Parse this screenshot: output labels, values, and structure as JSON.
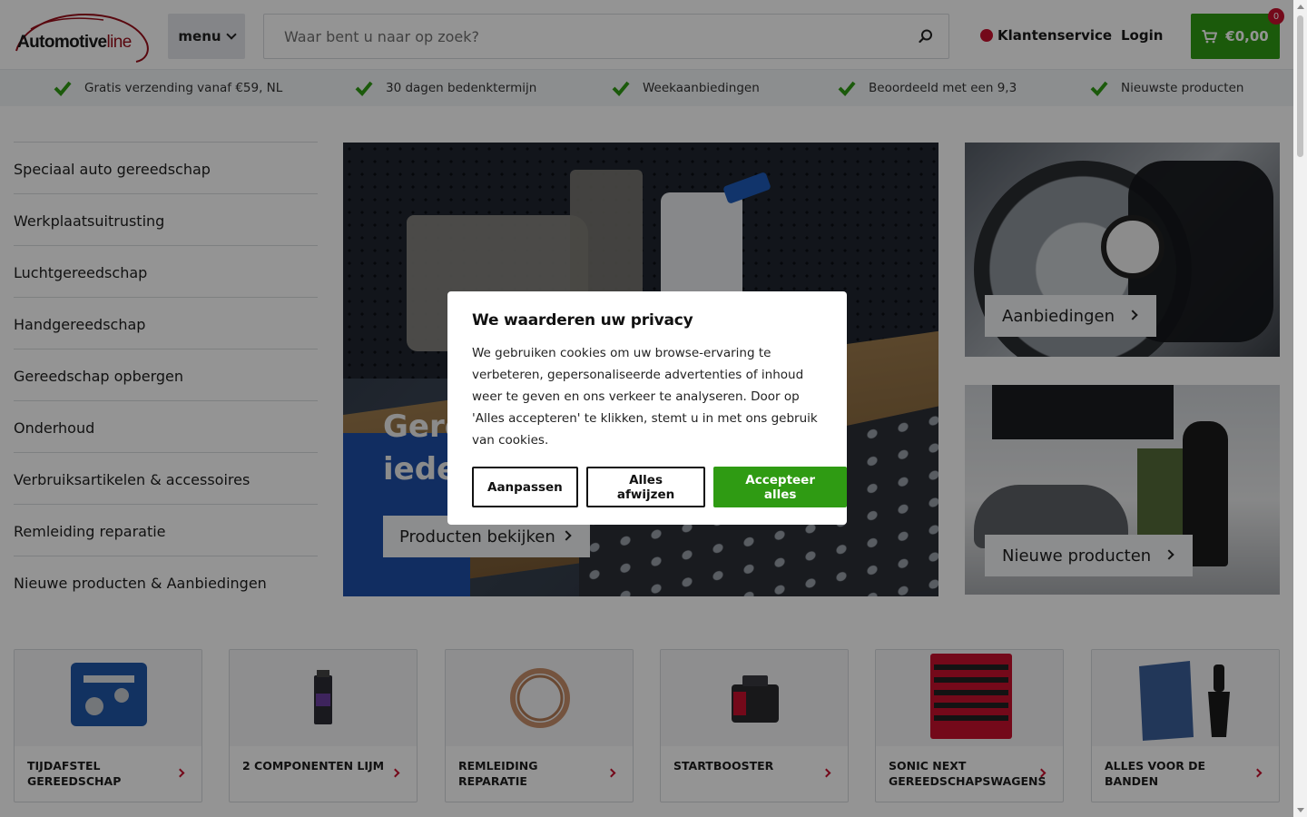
{
  "header": {
    "logo_main": "Automotive",
    "logo_accent": "line",
    "menu_label": "menu",
    "search_placeholder": "Waar bent u naar op zoek?",
    "service_label": "Klantenservice",
    "login_label": "Login",
    "cart_total": "€0,00",
    "cart_count": "0",
    "brand_color": "#2f9b13",
    "accent_color": "#c8102e"
  },
  "usp": [
    "Gratis verzending vanaf €59, NL",
    "30 dagen bedenktermijn",
    "Weekaanbiedingen",
    "Beoordeeld met een 9,3",
    "Nieuwste producten"
  ],
  "sidebar": {
    "items": [
      "Speciaal auto gereedschap",
      "Werkplaatsuitrusting",
      "Luchtgereedschap",
      "Handgereedschap",
      "Gereedschap opbergen",
      "Onderhoud",
      "Verbruiksartikelen & accessoires",
      "Remleiding reparatie",
      "Nieuwe producten & Aanbiedingen"
    ]
  },
  "hero": {
    "title_line1": "Gere",
    "title_line2": "iede",
    "button_label": "Producten bekijken"
  },
  "promos": {
    "offers_label": "Aanbiedingen",
    "new_label": "Nieuwe producten"
  },
  "categories": [
    {
      "label": "Tijdafstel gereedschap",
      "icon": "timing-tool-case"
    },
    {
      "label": "2 componenten lijm",
      "icon": "glue-tube"
    },
    {
      "label": "Remleiding reparatie",
      "icon": "copper-coil"
    },
    {
      "label": "Startbooster",
      "icon": "jump-starter"
    },
    {
      "label": "Sonic Next gereedschapswagens",
      "icon": "tool-trolley"
    },
    {
      "label": "Alles voor de banden",
      "icon": "tyre-valves"
    }
  ],
  "cookie_modal": {
    "title": "We waarderen uw privacy",
    "body": "We gebruiken cookies om uw browse-ervaring te verbeteren, gepersonaliseerde advertenties of inhoud weer te geven en ons verkeer te analyseren. Door op 'Alles accepteren' te klikken, stemt u in met ons gebruik van cookies.",
    "customize_label": "Aanpassen",
    "reject_label": "Alles afwijzen",
    "accept_label": "Accepteer alles"
  }
}
